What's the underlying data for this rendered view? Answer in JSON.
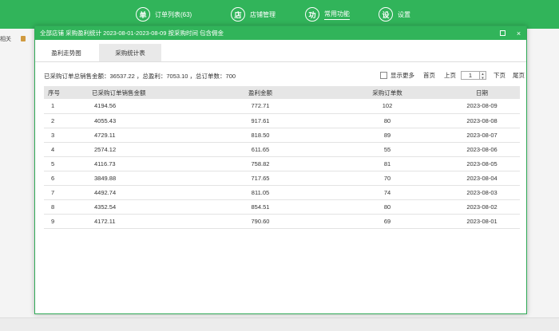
{
  "nav": {
    "items": [
      {
        "icon": "单",
        "label": "订单列表(63)"
      },
      {
        "icon": "店",
        "label": "店铺管理"
      },
      {
        "icon": "功",
        "label": "常用功能"
      },
      {
        "icon": "设",
        "label": "设置"
      }
    ]
  },
  "background": {
    "left_text": "相关"
  },
  "modal": {
    "title": "全部店铺 采购盈利统计 2023-08-01-2023-08-09 按采购时间 包含佣金",
    "maximize_label": "",
    "close_label": "×",
    "tabs": [
      {
        "label": "盈利走势图"
      },
      {
        "label": "采购统计表"
      }
    ],
    "summary": "已采购订单总销售金额：36537.22 ，总盈利：7053.10 ，总订单数：700",
    "pager": {
      "show_more": "显示更多",
      "first": "首页",
      "prev": "上页",
      "page": "1",
      "next": "下页",
      "last": "尾页"
    },
    "table": {
      "headers": [
        "序号",
        "已采购订单销售金额",
        "盈利金额",
        "采购订单数",
        "日期"
      ],
      "rows": [
        [
          "1",
          "4194.56",
          "772.71",
          "102",
          "2023-08-09"
        ],
        [
          "2",
          "4055.43",
          "917.61",
          "80",
          "2023-08-08"
        ],
        [
          "3",
          "4729.11",
          "818.50",
          "89",
          "2023-08-07"
        ],
        [
          "4",
          "2574.12",
          "611.65",
          "55",
          "2023-08-06"
        ],
        [
          "5",
          "4116.73",
          "758.82",
          "81",
          "2023-08-05"
        ],
        [
          "6",
          "3849.88",
          "717.65",
          "70",
          "2023-08-04"
        ],
        [
          "7",
          "4492.74",
          "811.05",
          "74",
          "2023-08-03"
        ],
        [
          "8",
          "4352.54",
          "854.51",
          "80",
          "2023-08-02"
        ],
        [
          "9",
          "4172.11",
          "790.60",
          "69",
          "2023-08-01"
        ]
      ]
    }
  }
}
